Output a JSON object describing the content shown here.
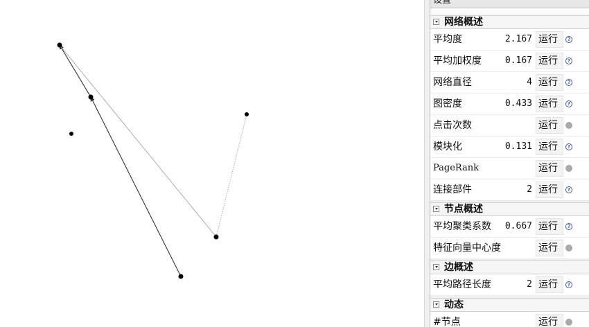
{
  "graph": {
    "nodes": [
      {
        "id": "n1"
      },
      {
        "id": "n2"
      },
      {
        "id": "n3"
      },
      {
        "id": "n4"
      },
      {
        "id": "n5"
      },
      {
        "id": "n6"
      }
    ],
    "edges": [
      {
        "from": "n2",
        "to": "n1",
        "style": "dark"
      },
      {
        "from": "n5",
        "to": "n2",
        "style": "dark"
      },
      {
        "from": "n4",
        "to": "n1",
        "style": "light"
      },
      {
        "from": "n6",
        "to": "n4",
        "style": "dotted"
      }
    ],
    "colors": {
      "node": "#000000",
      "edge_dark": "#333333",
      "edge_light": "#9a9a9a"
    }
  },
  "panel": {
    "header": "设置",
    "sections": [
      {
        "title": "网络概述",
        "rows": [
          {
            "label": "平均度",
            "value": "2.167",
            "run": "运行",
            "status": "help"
          },
          {
            "label": "平均加权度",
            "value": "0.167",
            "run": "运行",
            "status": "help"
          },
          {
            "label": "网络直径",
            "value": "4",
            "run": "运行",
            "status": "help"
          },
          {
            "label": "图密度",
            "value": "0.433",
            "run": "运行",
            "status": "help"
          },
          {
            "label": "点击次数",
            "value": "",
            "run": "运行",
            "status": "idle"
          },
          {
            "label": "模块化",
            "value": "0.131",
            "run": "运行",
            "status": "help"
          },
          {
            "label": "PageRank",
            "value": "",
            "run": "运行",
            "status": "idle"
          },
          {
            "label": "连接部件",
            "value": "2",
            "run": "运行",
            "status": "help"
          }
        ]
      },
      {
        "title": "节点概述",
        "rows": [
          {
            "label": "平均聚类系数",
            "value": "0.667",
            "run": "运行",
            "status": "help"
          },
          {
            "label": "特征向量中心度",
            "value": "",
            "run": "运行",
            "status": "idle"
          }
        ]
      },
      {
        "title": "边概述",
        "rows": [
          {
            "label": "平均路径长度",
            "value": "2",
            "run": "运行",
            "status": "help"
          }
        ]
      },
      {
        "title": "动态",
        "rows": [
          {
            "label": "#节点",
            "value": "",
            "run": "运行",
            "status": "idle"
          }
        ]
      }
    ],
    "help_glyph": "?"
  }
}
